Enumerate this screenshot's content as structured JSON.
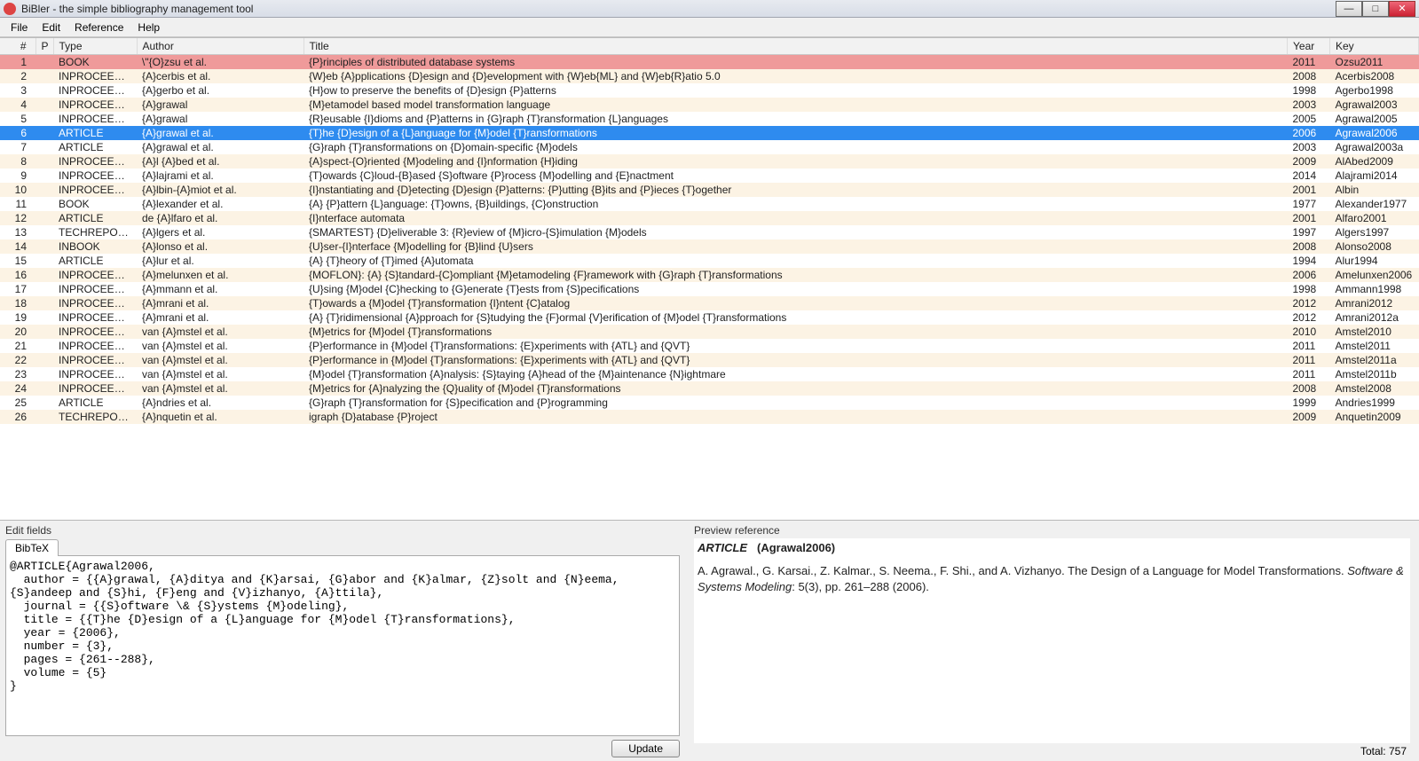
{
  "window": {
    "title": "BiBler - the simple bibliography management tool",
    "min_label": "—",
    "max_label": "□",
    "close_label": "✕"
  },
  "menu": [
    "File",
    "Edit",
    "Reference",
    "Help"
  ],
  "columns": [
    "#",
    "P",
    "Type",
    "Author",
    "Title",
    "Year",
    "Key"
  ],
  "rows": [
    {
      "n": "1",
      "type": "BOOK",
      "author": "\\\"{O}zsu et al.",
      "title": "{P}rinciples of distributed database systems",
      "year": "2011",
      "key": "Ozsu2011",
      "flag": true
    },
    {
      "n": "2",
      "type": "INPROCEEDIN...",
      "author": "{A}cerbis et al.",
      "title": "{W}eb {A}pplications {D}esign and {D}evelopment with {W}eb{ML} and {W}eb{R}atio 5.0",
      "year": "2008",
      "key": "Acerbis2008"
    },
    {
      "n": "3",
      "type": "INPROCEEDIN...",
      "author": "{A}gerbo et al.",
      "title": "{H}ow to preserve the benefits of {D}esign {P}atterns",
      "year": "1998",
      "key": "Agerbo1998"
    },
    {
      "n": "4",
      "type": "INPROCEEDIN...",
      "author": "{A}grawal",
      "title": "{M}etamodel based model transformation language",
      "year": "2003",
      "key": "Agrawal2003"
    },
    {
      "n": "5",
      "type": "INPROCEEDIN...",
      "author": "{A}grawal",
      "title": "{R}eusable {I}dioms and {P}atterns in {G}raph {T}ransformation {L}anguages",
      "year": "2005",
      "key": "Agrawal2005"
    },
    {
      "n": "6",
      "type": "ARTICLE",
      "author": "{A}grawal et al.",
      "title": "{T}he {D}esign of a {L}anguage for {M}odel {T}ransformations",
      "year": "2006",
      "key": "Agrawal2006",
      "selected": true
    },
    {
      "n": "7",
      "type": "ARTICLE",
      "author": "{A}grawal et al.",
      "title": "{G}raph {T}ransformations on {D}omain-specific {M}odels",
      "year": "2003",
      "key": "Agrawal2003a"
    },
    {
      "n": "8",
      "type": "INPROCEEDIN...",
      "author": "{A}l {A}bed et al.",
      "title": "{A}spect-{O}riented {M}odeling and {I}nformation {H}iding",
      "year": "2009",
      "key": "AlAbed2009"
    },
    {
      "n": "9",
      "type": "INPROCEEDIN...",
      "author": "{A}lajrami et al.",
      "title": "{T}owards {C}loud-{B}ased {S}oftware {P}rocess {M}odelling and {E}nactment",
      "year": "2014",
      "key": "Alajrami2014"
    },
    {
      "n": "10",
      "type": "INPROCEEDIN...",
      "author": "{A}lbin-{A}miot et al.",
      "title": "{I}nstantiating and {D}etecting {D}esign {P}atterns: {P}utting {B}its and {P}ieces {T}ogether",
      "year": "2001",
      "key": "Albin"
    },
    {
      "n": "11",
      "type": "BOOK",
      "author": "{A}lexander et al.",
      "title": "{A} {P}attern {L}anguage: {T}owns, {B}uildings, {C}onstruction",
      "year": "1977",
      "key": "Alexander1977"
    },
    {
      "n": "12",
      "type": "ARTICLE",
      "author": "de {A}lfaro et al.",
      "title": "{I}nterface automata",
      "year": "2001",
      "key": "Alfaro2001"
    },
    {
      "n": "13",
      "type": "TECHREPORT",
      "author": "{A}lgers et al.",
      "title": "{SMARTEST} {D}eliverable 3: {R}eview of {M}icro-{S}imulation {M}odels",
      "year": "1997",
      "key": "Algers1997"
    },
    {
      "n": "14",
      "type": "INBOOK",
      "author": "{A}lonso et al.",
      "title": "{U}ser-{I}nterface {M}odelling for {B}lind {U}sers",
      "year": "2008",
      "key": "Alonso2008"
    },
    {
      "n": "15",
      "type": "ARTICLE",
      "author": "{A}lur et al.",
      "title": "{A} {T}heory of {T}imed {A}utomata",
      "year": "1994",
      "key": "Alur1994"
    },
    {
      "n": "16",
      "type": "INPROCEEDIN...",
      "author": "{A}melunxen et al.",
      "title": "{MOFLON}: {A} {S}tandard-{C}ompliant {M}etamodeling {F}ramework with {G}raph {T}ransformations",
      "year": "2006",
      "key": "Amelunxen2006"
    },
    {
      "n": "17",
      "type": "INPROCEEDIN...",
      "author": "{A}mmann et al.",
      "title": "{U}sing {M}odel {C}hecking to {G}enerate {T}ests from {S}pecifications",
      "year": "1998",
      "key": "Ammann1998"
    },
    {
      "n": "18",
      "type": "INPROCEEDIN...",
      "author": "{A}mrani et al.",
      "title": "{T}owards a {M}odel {T}ransformation {I}ntent {C}atalog",
      "year": "2012",
      "key": "Amrani2012"
    },
    {
      "n": "19",
      "type": "INPROCEEDIN...",
      "author": "{A}mrani et al.",
      "title": "{A} {T}ridimensional {A}pproach for {S}tudying the {F}ormal {V}erification of {M}odel {T}ransformations",
      "year": "2012",
      "key": "Amrani2012a"
    },
    {
      "n": "20",
      "type": "INPROCEEDIN...",
      "author": "van {A}mstel et al.",
      "title": "{M}etrics for {M}odel {T}ransformations",
      "year": "2010",
      "key": "Amstel2010"
    },
    {
      "n": "21",
      "type": "INPROCEEDIN...",
      "author": "van {A}mstel et al.",
      "title": "{P}erformance in {M}odel {T}ransformations: {E}xperiments with {ATL} and {QVT}",
      "year": "2011",
      "key": "Amstel2011"
    },
    {
      "n": "22",
      "type": "INPROCEEDIN...",
      "author": "van {A}mstel et al.",
      "title": "{P}erformance in {M}odel {T}ransformations: {E}xperiments with {ATL} and {QVT}",
      "year": "2011",
      "key": "Amstel2011a"
    },
    {
      "n": "23",
      "type": "INPROCEEDIN...",
      "author": "van {A}mstel et al.",
      "title": "{M}odel {T}ransformation {A}nalysis: {S}taying {A}head of the {M}aintenance {N}ightmare",
      "year": "2011",
      "key": "Amstel2011b"
    },
    {
      "n": "24",
      "type": "INPROCEEDIN...",
      "author": "van {A}mstel et al.",
      "title": "{M}etrics for {A}nalyzing the {Q}uality of {M}odel {T}ransformations",
      "year": "2008",
      "key": "Amstel2008"
    },
    {
      "n": "25",
      "type": "ARTICLE",
      "author": "{A}ndries et al.",
      "title": "{G}raph {T}ransformation for {S}pecification and {P}rogramming",
      "year": "1999",
      "key": "Andries1999"
    },
    {
      "n": "26",
      "type": "TECHREPORT",
      "author": "{A}nquetin et al.",
      "title": "igraph {D}atabase {P}roject",
      "year": "2009",
      "key": "Anquetin2009"
    }
  ],
  "edit": {
    "pane_label": "Edit fields",
    "tab": "BibTeX",
    "text": "@ARTICLE{Agrawal2006,\n  author = {{A}grawal, {A}ditya and {K}arsai, {G}abor and {K}almar, {Z}solt and {N}eema, {S}andeep and {S}hi, {F}eng and {V}izhanyo, {A}ttila},\n  journal = {{S}oftware \\& {S}ystems {M}odeling},\n  title = {{T}he {D}esign of a {L}anguage for {M}odel {T}ransformations},\n  year = {2006},\n  number = {3},\n  pages = {261--288},\n  volume = {5}\n}",
    "update_label": "Update"
  },
  "preview": {
    "pane_label": "Preview reference",
    "type": "ARTICLE",
    "key": "(Agrawal2006)",
    "authors": "A. Agrawal., G. Karsai., Z. Kalmar., S. Neema., F. Shi., and A. Vizhanyo. ",
    "title": "The Design of a Language for Model Transformations. ",
    "journal": "Software & Systems Modeling",
    "rest": ": 5(3), pp. 261–288 (2006)."
  },
  "total_label": "Total: 757"
}
